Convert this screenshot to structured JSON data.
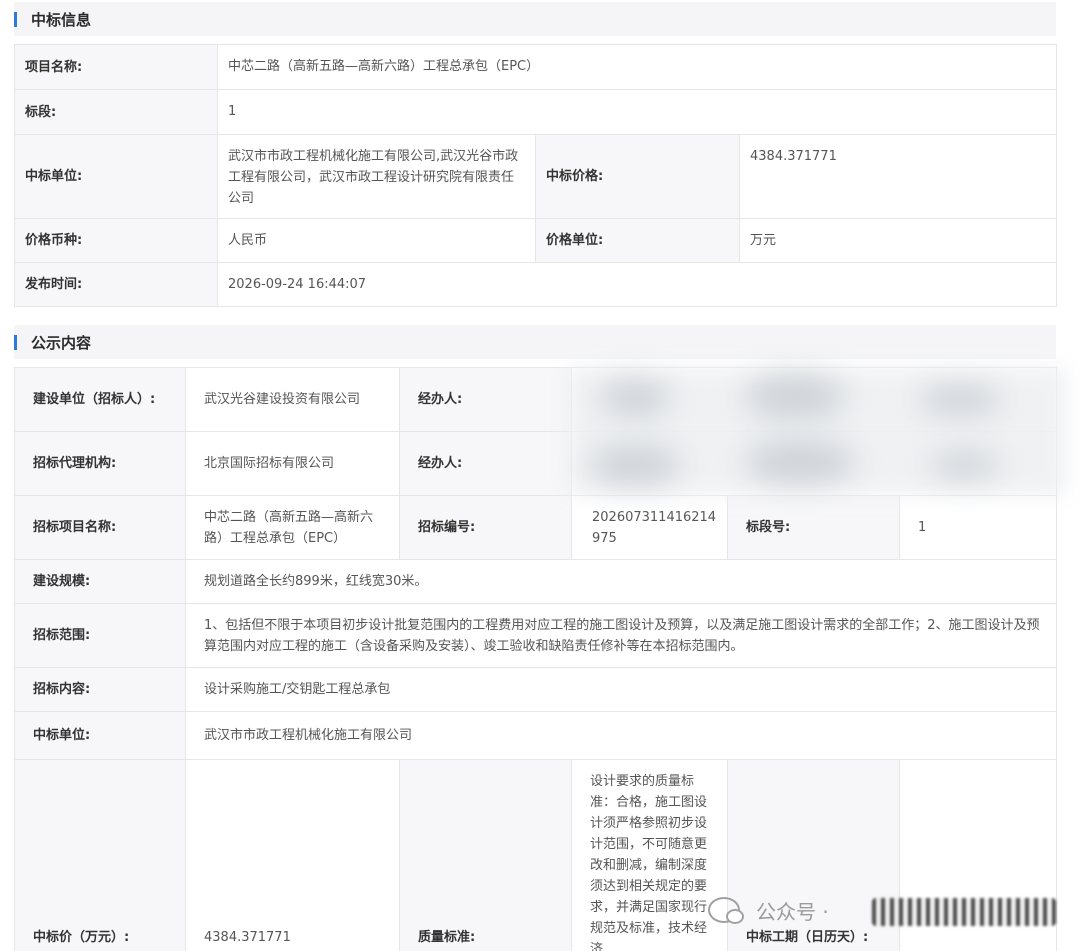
{
  "section1": {
    "title": "中标信息",
    "rows": {
      "project_name_label": "项目名称:",
      "project_name": "中芯二路（高新五路—高新六路）工程总承包（EPC）",
      "lot_label": "标段:",
      "lot": "1",
      "winner_label": "中标单位:",
      "winner": "武汉市市政工程机械化施工有限公司,武汉光谷市政工程有限公司，武汉市政工程设计研究院有限责任公司",
      "price_label": "中标价格:",
      "price": "4384.371771",
      "currency_label": "价格币种:",
      "currency": "人民币",
      "unit_label": "价格单位:",
      "unit": "万元",
      "publish_time_label": "发布时间:",
      "publish_time": "2026-09-24 16:44:07"
    }
  },
  "section2": {
    "title": "公示内容",
    "rows": {
      "builder_label": "建设单位（招标人）:",
      "builder": "武汉光谷建设投资有限公司",
      "handler1_label": "经办人:",
      "agency_label": "招标代理机构:",
      "agency": "北京国际招标有限公司",
      "handler2_label": "经办人:",
      "tender_project_label": "招标项目名称:",
      "tender_project": "中芯二路（高新五路—高新六路）工程总承包（EPC）",
      "tender_no_label": "招标编号:",
      "tender_no": "202607311416214975",
      "lot_no_label": "标段号:",
      "lot_no": "1",
      "scale_label": "建设规模:",
      "scale": "规划道路全长约899米，红线宽30米。",
      "scope_label": "招标范围:",
      "scope": "1、包括但不限于本项目初步设计批复范围内的工程费用对应工程的施工图设计及预算，以及满足施工图设计需求的全部工作；2、施工图设计及预算范围内对应工程的施工（含设备采购及安装）、竣工验收和缺陷责任修补等在本招标范围内。",
      "content_label": "招标内容:",
      "content": "设计采购施工/交钥匙工程总承包",
      "winner_label": "中标单位:",
      "winner": "武汉市市政工程机械化施工有限公司",
      "price_label": "中标价（万元）:",
      "price": "4384.371771",
      "quality_label": "质量标准:",
      "quality": "设计要求的质量标准：合格，施工图设计须严格参照初步设计范围，不可随意更改和删减，编制深度须达到相关规定的要求，并满足国家现行规范及标准，技术经济",
      "period_label": "中标工期（日历天）:"
    }
  },
  "watermark": {
    "text": "公众号 ·"
  }
}
